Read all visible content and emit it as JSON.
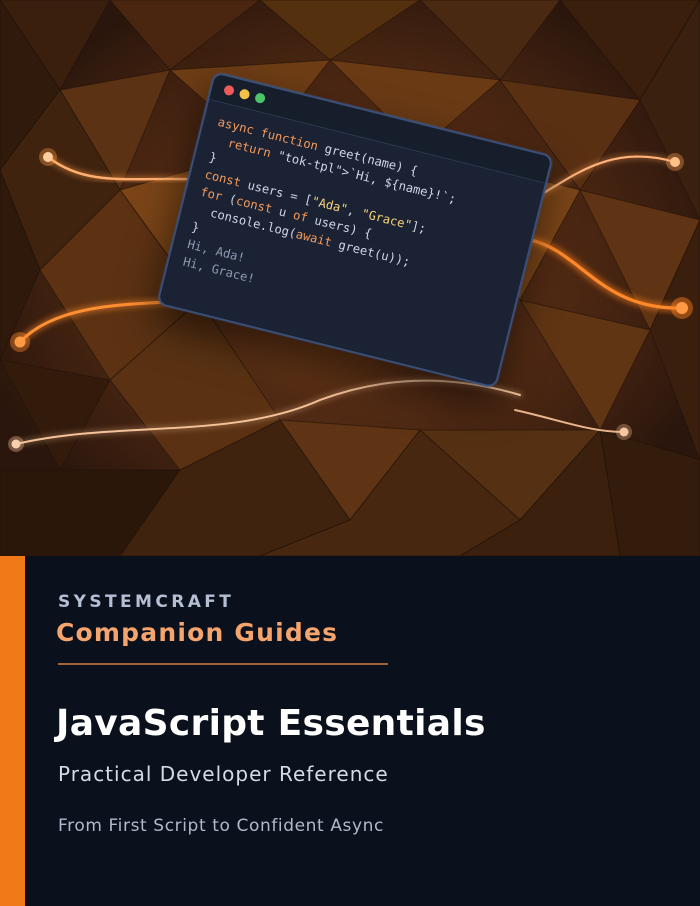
{
  "colors": {
    "accent": "#f07a18",
    "series_text": "#f4a46c",
    "background_dark": "#0b111c"
  },
  "artwork": {
    "code_window": {
      "controls": [
        "close",
        "minimize",
        "maximize"
      ],
      "lines": [
        "async function greet(name) {",
        "  return `Hi, ${name}!`;",
        "}",
        "const users = [\"Ada\", \"Grace\"];",
        "for (const u of users) {",
        "  console.log(await greet(u));",
        "}",
        "Hi, Ada!",
        "Hi, Grace!"
      ]
    }
  },
  "cover": {
    "brand": "SYSTEMCRAFT",
    "series": "Companion Guides",
    "title": "JavaScript Essentials",
    "subtitle": "Practical Developer Reference",
    "tagline": "From First Script to Confident Async"
  }
}
